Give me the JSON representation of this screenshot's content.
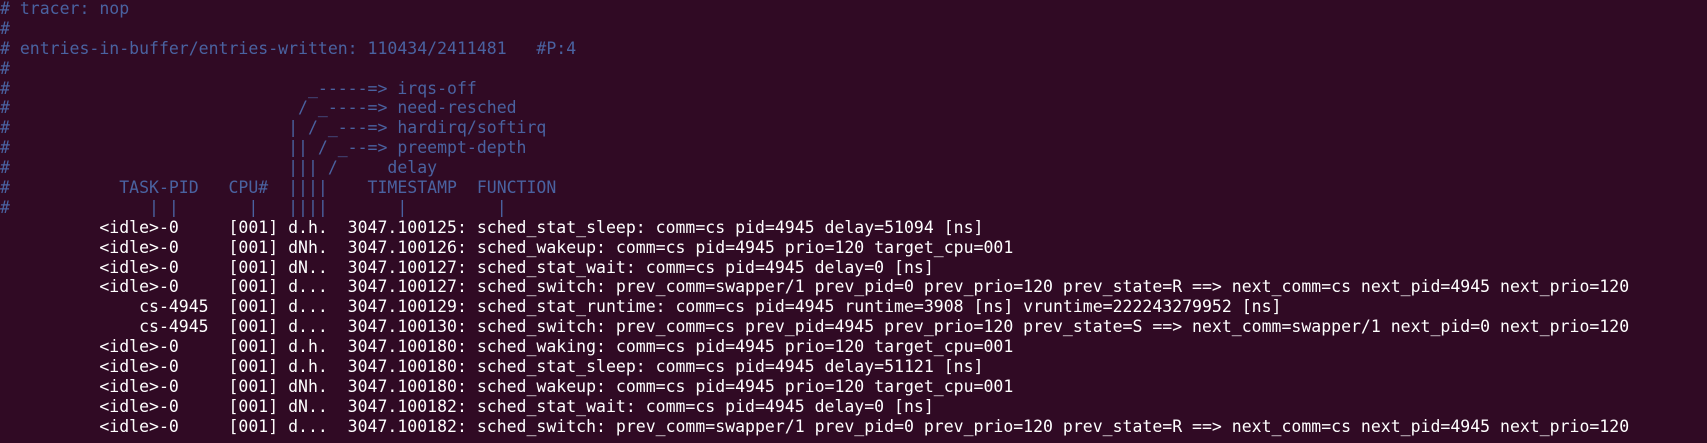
{
  "terminal": {
    "background": "#300a24",
    "comment_color": "#4a62a0",
    "text_color": "#ffffff",
    "header_lines": [
      "# tracer: nop",
      "#",
      "# entries-in-buffer/entries-written: 110434/2411481   #P:4",
      "#",
      "#                              _-----=> irqs-off",
      "#                             / _----=> need-resched",
      "#                            | / _---=> hardirq/softirq",
      "#                            || / _--=> preempt-depth",
      "#                            ||| /     delay",
      "#           TASK-PID   CPU#  ||||    TIMESTAMP  FUNCTION",
      "#              | |       |   ||||       |         |"
    ],
    "entries": [
      "          <idle>-0     [001] d.h.  3047.100125: sched_stat_sleep: comm=cs pid=4945 delay=51094 [ns]",
      "          <idle>-0     [001] dNh.  3047.100126: sched_wakeup: comm=cs pid=4945 prio=120 target_cpu=001",
      "          <idle>-0     [001] dN..  3047.100127: sched_stat_wait: comm=cs pid=4945 delay=0 [ns]",
      "          <idle>-0     [001] d...  3047.100127: sched_switch: prev_comm=swapper/1 prev_pid=0 prev_prio=120 prev_state=R ==> next_comm=cs next_pid=4945 next_prio=120",
      "              cs-4945  [001] d...  3047.100129: sched_stat_runtime: comm=cs pid=4945 runtime=3908 [ns] vruntime=222243279952 [ns]",
      "              cs-4945  [001] d...  3047.100130: sched_switch: prev_comm=cs prev_pid=4945 prev_prio=120 prev_state=S ==> next_comm=swapper/1 next_pid=0 next_prio=120",
      "          <idle>-0     [001] d.h.  3047.100180: sched_waking: comm=cs pid=4945 prio=120 target_cpu=001",
      "          <idle>-0     [001] d.h.  3047.100180: sched_stat_sleep: comm=cs pid=4945 delay=51121 [ns]",
      "          <idle>-0     [001] dNh.  3047.100180: sched_wakeup: comm=cs pid=4945 prio=120 target_cpu=001",
      "          <idle>-0     [001] dN..  3047.100182: sched_stat_wait: comm=cs pid=4945 delay=0 [ns]",
      "          <idle>-0     [001] d...  3047.100182: sched_switch: prev_comm=swapper/1 prev_pid=0 prev_prio=120 prev_state=R ==> next_comm=cs next_pid=4945 next_prio=120"
    ]
  }
}
